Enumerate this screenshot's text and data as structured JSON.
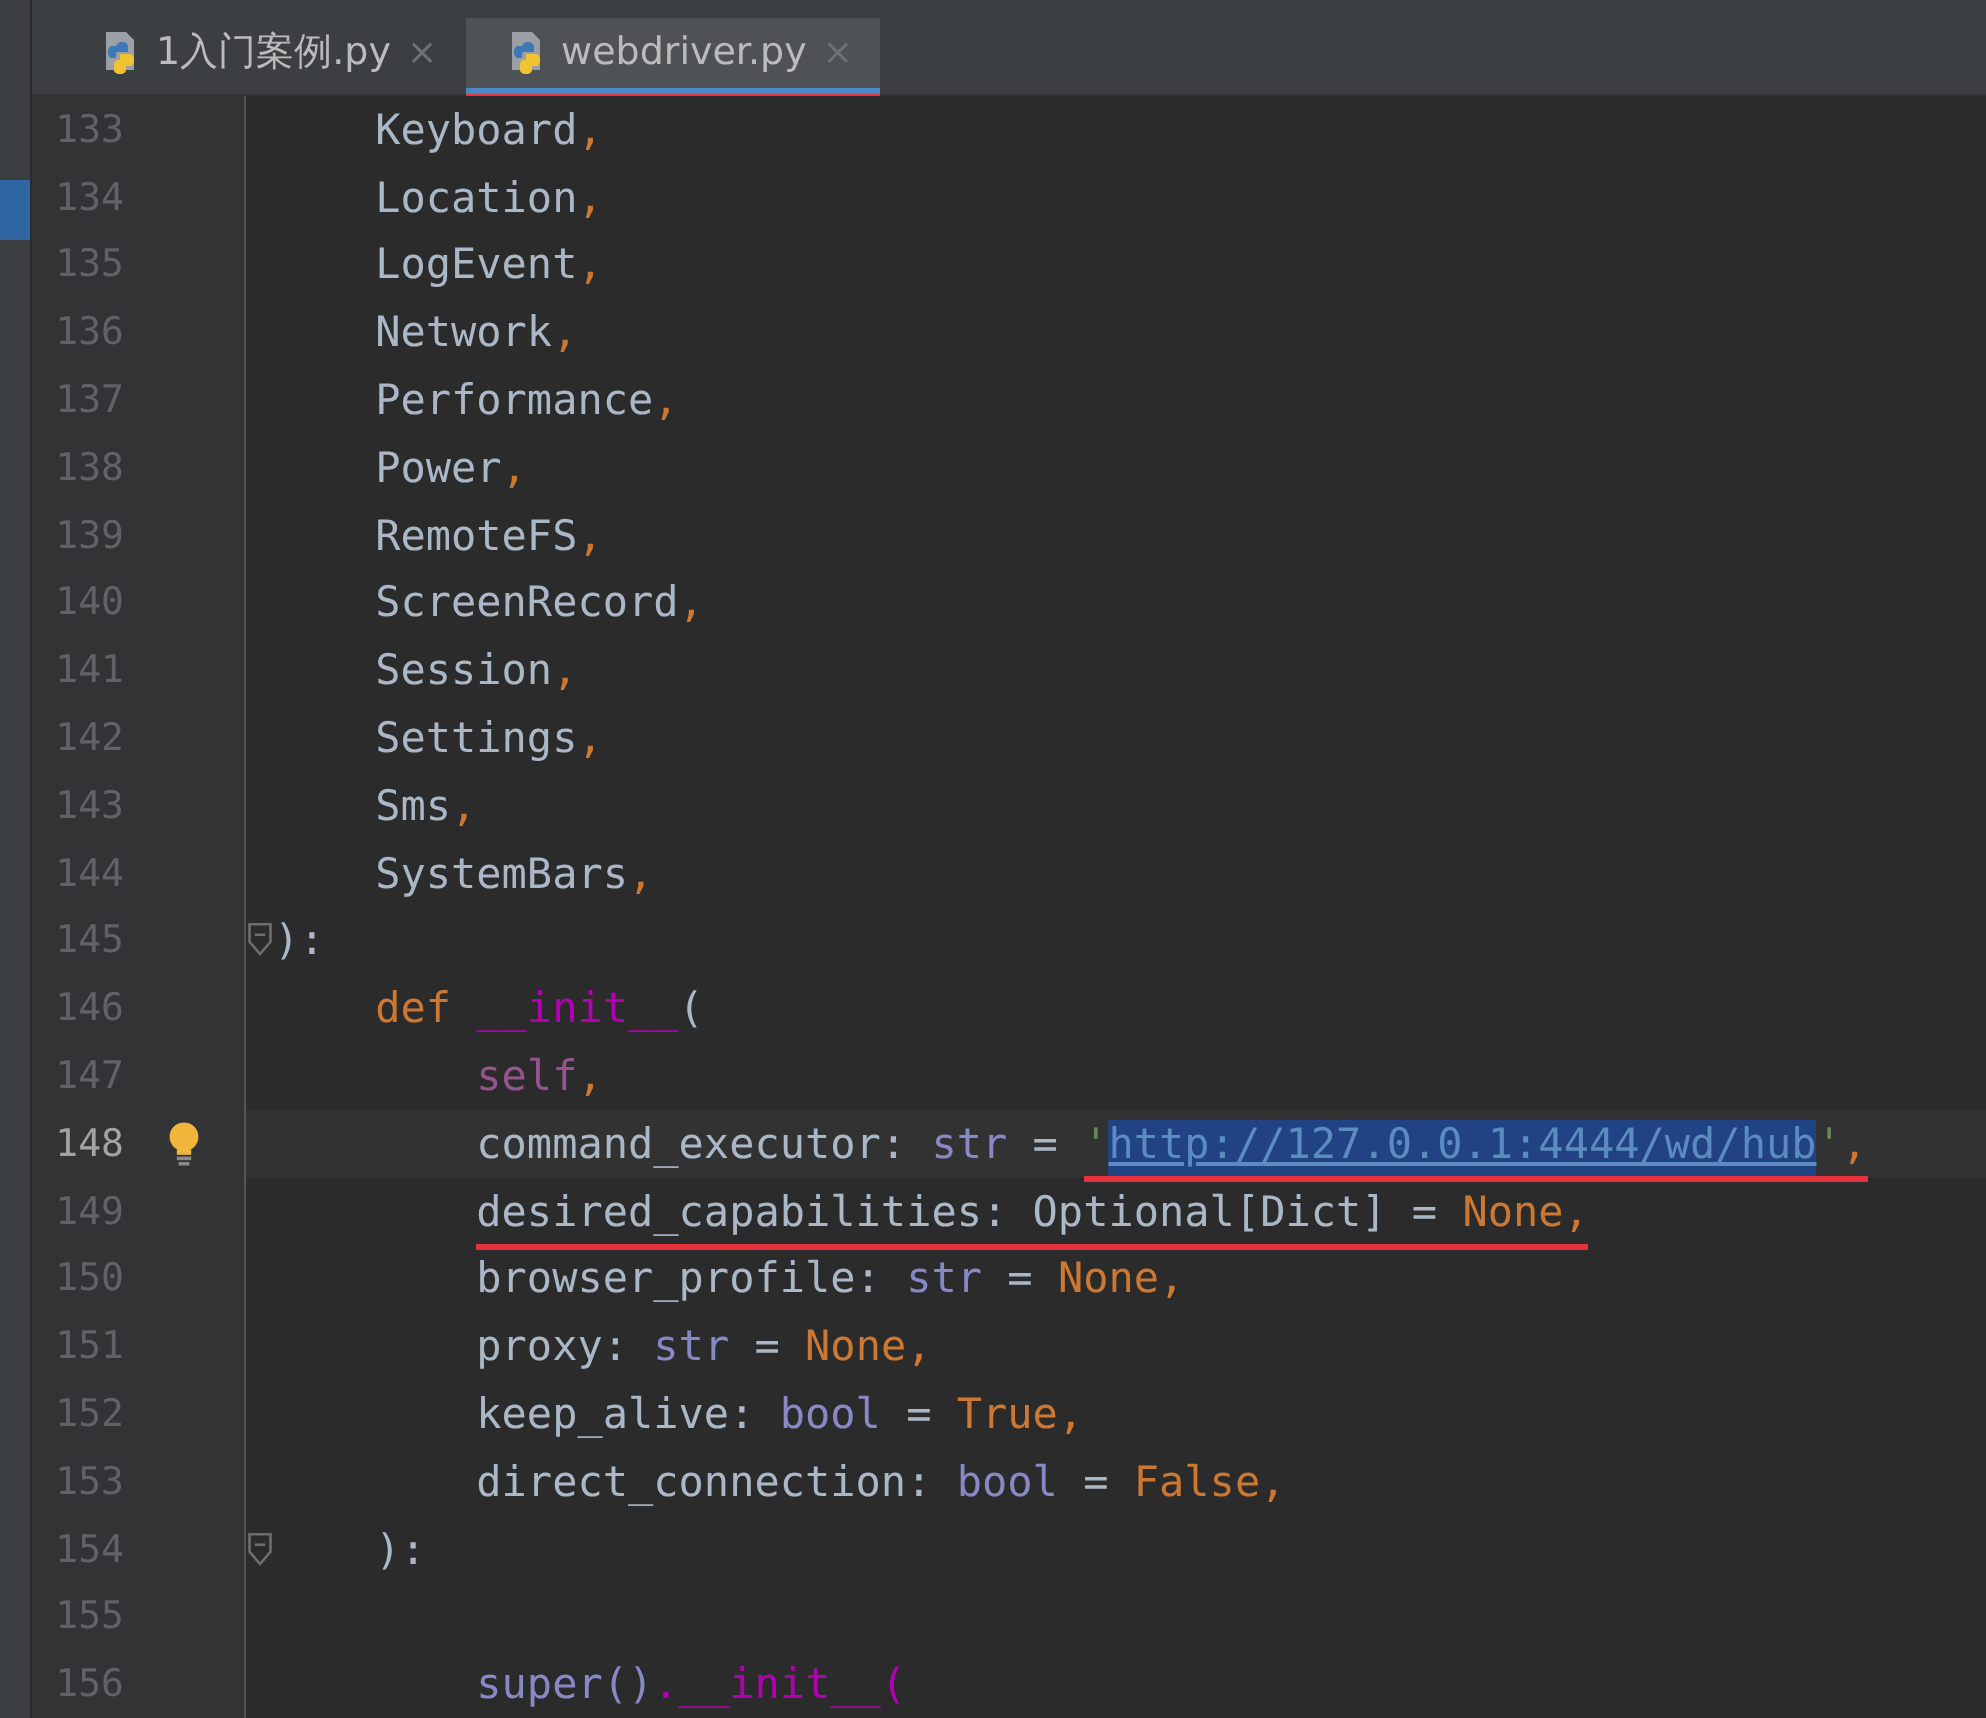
{
  "tabs": [
    {
      "label": "1入门案例.py",
      "close": "×",
      "selected": false,
      "marked": false
    },
    {
      "label": "webdriver.py",
      "close": "×",
      "selected": true,
      "marked": true
    }
  ],
  "editor": {
    "lines": [
      {
        "number": "133",
        "kind": "single",
        "current": false,
        "fold": false,
        "bulb": false,
        "tokens": [
          {
            "kind": "plain",
            "text": "Keyboard",
            "marked": false
          },
          {
            "kind": "punct",
            "text": ",",
            "marked": false
          }
        ]
      },
      {
        "number": "134",
        "kind": "single",
        "current": false,
        "fold": false,
        "bulb": false,
        "tokens": [
          {
            "kind": "plain",
            "text": "Location",
            "marked": false
          },
          {
            "kind": "punct",
            "text": ",",
            "marked": false
          }
        ]
      },
      {
        "number": "135",
        "kind": "single",
        "current": false,
        "fold": false,
        "bulb": false,
        "tokens": [
          {
            "kind": "plain",
            "text": "LogEvent",
            "marked": false
          },
          {
            "kind": "punct",
            "text": ",",
            "marked": false
          }
        ]
      },
      {
        "number": "136",
        "kind": "single",
        "current": false,
        "fold": false,
        "bulb": false,
        "tokens": [
          {
            "kind": "plain",
            "text": "Network",
            "marked": false
          },
          {
            "kind": "punct",
            "text": ",",
            "marked": false
          }
        ]
      },
      {
        "number": "137",
        "kind": "single",
        "current": false,
        "fold": false,
        "bulb": false,
        "tokens": [
          {
            "kind": "plain",
            "text": "Performance",
            "marked": false
          },
          {
            "kind": "punct",
            "text": ",",
            "marked": false
          }
        ]
      },
      {
        "number": "138",
        "kind": "single",
        "current": false,
        "fold": false,
        "bulb": false,
        "tokens": [
          {
            "kind": "plain",
            "text": "Power",
            "marked": false
          },
          {
            "kind": "punct",
            "text": ",",
            "marked": false
          }
        ]
      },
      {
        "number": "139",
        "kind": "single",
        "current": false,
        "fold": false,
        "bulb": false,
        "tokens": [
          {
            "kind": "plain",
            "text": "RemoteFS",
            "marked": false
          },
          {
            "kind": "punct",
            "text": ",",
            "marked": false
          }
        ]
      },
      {
        "number": "140",
        "kind": "single",
        "current": false,
        "fold": false,
        "bulb": false,
        "tokens": [
          {
            "kind": "plain",
            "text": "ScreenRecord",
            "marked": false
          },
          {
            "kind": "punct",
            "text": ",",
            "marked": false
          }
        ]
      },
      {
        "number": "141",
        "kind": "single",
        "current": false,
        "fold": false,
        "bulb": false,
        "tokens": [
          {
            "kind": "plain",
            "text": "Session",
            "marked": false
          },
          {
            "kind": "punct",
            "text": ",",
            "marked": false
          }
        ]
      },
      {
        "number": "142",
        "kind": "single",
        "current": false,
        "fold": false,
        "bulb": false,
        "tokens": [
          {
            "kind": "plain",
            "text": "Settings",
            "marked": false
          },
          {
            "kind": "punct",
            "text": ",",
            "marked": false
          }
        ]
      },
      {
        "number": "143",
        "kind": "single",
        "current": false,
        "fold": false,
        "bulb": false,
        "tokens": [
          {
            "kind": "plain",
            "text": "Sms",
            "marked": false
          },
          {
            "kind": "punct",
            "text": ",",
            "marked": false
          }
        ]
      },
      {
        "number": "144",
        "kind": "single",
        "current": false,
        "fold": false,
        "bulb": false,
        "tokens": [
          {
            "kind": "plain",
            "text": "SystemBars",
            "marked": false
          },
          {
            "kind": "punct",
            "text": ",",
            "marked": false
          }
        ]
      },
      {
        "number": "145",
        "kind": "none",
        "current": false,
        "fold": true,
        "bulb": false,
        "tokens": [
          {
            "kind": "plain",
            "text": "):",
            "marked": false
          }
        ]
      },
      {
        "number": "146",
        "kind": "single",
        "current": false,
        "fold": false,
        "bulb": false,
        "tokens": [
          {
            "kind": "keyword",
            "text": "def ",
            "marked": false
          },
          {
            "kind": "magic",
            "text": "__init__",
            "marked": false
          },
          {
            "kind": "plain",
            "text": "(",
            "marked": false
          }
        ]
      },
      {
        "number": "147",
        "kind": "double",
        "current": false,
        "fold": false,
        "bulb": false,
        "tokens": [
          {
            "kind": "self",
            "text": "self",
            "marked": false
          },
          {
            "kind": "punct",
            "text": ",",
            "marked": false
          }
        ]
      },
      {
        "number": "148",
        "kind": "double",
        "current": true,
        "fold": false,
        "bulb": true,
        "tokens": [
          {
            "kind": "plain",
            "text": "command_executor: ",
            "marked": false
          },
          {
            "kind": "type",
            "text": "str",
            "marked": false
          },
          {
            "kind": "plain",
            "text": " = ",
            "marked": false
          },
          {
            "kind": "string",
            "text": "'",
            "marked": true
          },
          {
            "kind": "url",
            "text": "http://127.0.0.1:4444/wd/hub",
            "marked": true
          },
          {
            "kind": "string",
            "text": "'",
            "marked": true
          },
          {
            "kind": "punct",
            "text": ",",
            "marked": true
          }
        ]
      },
      {
        "number": "149",
        "kind": "double",
        "current": false,
        "fold": false,
        "bulb": false,
        "tokens": [
          {
            "kind": "plain",
            "text": "desired_capabilities: Optional[Dict] = ",
            "marked": true
          },
          {
            "kind": "const",
            "text": "None,",
            "marked": true
          }
        ]
      },
      {
        "number": "150",
        "kind": "double",
        "current": false,
        "fold": false,
        "bulb": false,
        "tokens": [
          {
            "kind": "plain",
            "text": "browser_profile: ",
            "marked": false
          },
          {
            "kind": "type",
            "text": "str",
            "marked": false
          },
          {
            "kind": "plain",
            "text": " = ",
            "marked": false
          },
          {
            "kind": "const",
            "text": "None,",
            "marked": false
          }
        ]
      },
      {
        "number": "151",
        "kind": "double",
        "current": false,
        "fold": false,
        "bulb": false,
        "tokens": [
          {
            "kind": "plain",
            "text": "proxy: ",
            "marked": false
          },
          {
            "kind": "type",
            "text": "str",
            "marked": false
          },
          {
            "kind": "plain",
            "text": " = ",
            "marked": false
          },
          {
            "kind": "const",
            "text": "None,",
            "marked": false
          }
        ]
      },
      {
        "number": "152",
        "kind": "double",
        "current": false,
        "fold": false,
        "bulb": false,
        "tokens": [
          {
            "kind": "plain",
            "text": "keep_alive: ",
            "marked": false
          },
          {
            "kind": "type",
            "text": "bool",
            "marked": false
          },
          {
            "kind": "plain",
            "text": " = ",
            "marked": false
          },
          {
            "kind": "const",
            "text": "True,",
            "marked": false
          }
        ]
      },
      {
        "number": "153",
        "kind": "double",
        "current": false,
        "fold": false,
        "bulb": false,
        "tokens": [
          {
            "kind": "plain",
            "text": "direct_connection: ",
            "marked": false
          },
          {
            "kind": "type",
            "text": "bool",
            "marked": false
          },
          {
            "kind": "plain",
            "text": " = ",
            "marked": false
          },
          {
            "kind": "const",
            "text": "False,",
            "marked": false
          }
        ]
      },
      {
        "number": "154",
        "kind": "single",
        "current": false,
        "fold": true,
        "bulb": false,
        "tokens": [
          {
            "kind": "plain",
            "text": "):",
            "marked": false
          }
        ]
      },
      {
        "number": "155",
        "kind": "none",
        "current": false,
        "fold": false,
        "bulb": false
      },
      {
        "number": "156",
        "kind": "double",
        "current": false,
        "fold": false,
        "bulb": false,
        "tokens": [
          {
            "kind": "type",
            "text": "super()",
            "marked": false
          },
          {
            "kind": "magic",
            "text": ".__init__(",
            "marked": false
          }
        ]
      }
    ]
  }
}
